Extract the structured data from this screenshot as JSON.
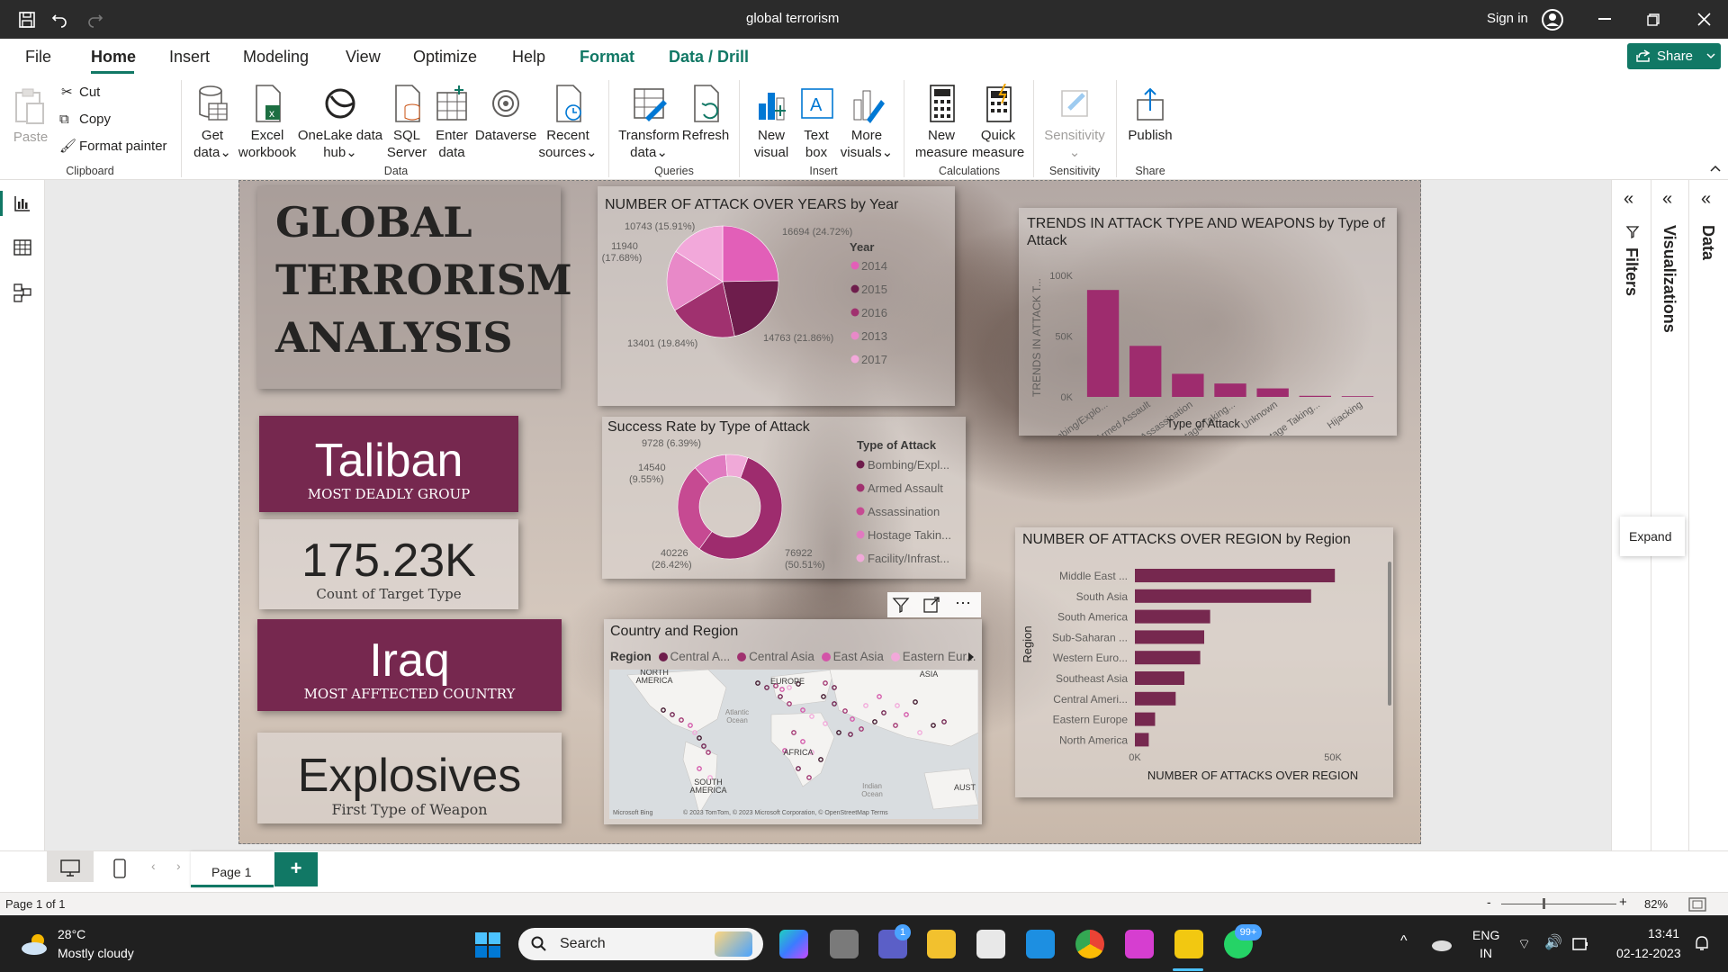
{
  "window": {
    "title": "global terrorism",
    "sign_in": "Sign in"
  },
  "menu": {
    "items": [
      "File",
      "Home",
      "Insert",
      "Modeling",
      "View",
      "Optimize",
      "Help",
      "Format",
      "Data / Drill"
    ],
    "share": "Share"
  },
  "ribbon": {
    "clipboard": {
      "paste": "Paste",
      "cut": "Cut",
      "copy": "Copy",
      "format_painter": "Format painter",
      "group": "Clipboard"
    },
    "data": {
      "get_data_1": "Get",
      "get_data_2": "data",
      "excel_1": "Excel",
      "excel_2": "workbook",
      "onelake_1": "OneLake data",
      "onelake_2": "hub",
      "sql_1": "SQL",
      "sql_2": "Server",
      "enter_1": "Enter",
      "enter_2": "data",
      "dataverse": "Dataverse",
      "recent_1": "Recent",
      "recent_2": "sources",
      "group": "Data"
    },
    "queries": {
      "transform_1": "Transform",
      "transform_2": "data",
      "refresh": "Refresh",
      "group": "Queries"
    },
    "insert": {
      "new_visual_1": "New",
      "new_visual_2": "visual",
      "text_box_1": "Text",
      "text_box_2": "box",
      "more_visuals_1": "More",
      "more_visuals_2": "visuals",
      "group": "Insert"
    },
    "calculations": {
      "new_measure_1": "New",
      "new_measure_2": "measure",
      "quick_measure_1": "Quick",
      "quick_measure_2": "measure",
      "group": "Calculations"
    },
    "sensitivity": {
      "label": "Sensitivity",
      "group": "Sensitivity"
    },
    "share": {
      "publish": "Publish",
      "group": "Share"
    }
  },
  "report": {
    "main_title": [
      "GLOBAL",
      "TERRORISM",
      "ANALYSIS"
    ],
    "kpi_group": {
      "value": "Taliban",
      "label": "MOST DEADLY GROUP"
    },
    "kpi_count": {
      "value": "175.23K",
      "label": "Count of Target Type"
    },
    "kpi_country": {
      "value": "Iraq",
      "label": "MOST AFFTECTED COUNTRY"
    },
    "kpi_weapon": {
      "value": "Explosives",
      "label": "First Type of Weapon"
    },
    "map": {
      "title": "Country and Region",
      "legend_title": "Region",
      "legend": [
        "Central A...",
        "Central Asia",
        "East Asia",
        "Eastern Eur..."
      ],
      "labels": {
        "na": "NORTH AMERICA",
        "europe": "EUROPE",
        "africa": "AFRICA",
        "sa": "SOUTH AMERICA",
        "asia": "ASIA",
        "atlantic": "Atlantic Ocean",
        "indian": "Indian Ocean",
        "aust": "AUST"
      },
      "credit": "© 2023 TomTom, © 2023 Microsoft Corporation, © OpenStreetMap  Terms",
      "bing": "Microsoft Bing"
    },
    "expand_tooltip": "Expand"
  },
  "chart_data": [
    {
      "type": "pie",
      "title": "NUMBER OF ATTACK OVER YEARS by Year",
      "legend_title": "Year",
      "categories": [
        "2014",
        "2015",
        "2016",
        "2013",
        "2017"
      ],
      "values": [
        16694,
        14763,
        13401,
        11940,
        10743
      ],
      "labels": [
        "16694 (24.72%)",
        "14763 (21.86%)",
        "13401 (19.84%)",
        "11940 (17.68%)",
        "10743 (15.91%)"
      ],
      "colors": [
        "#e25fb8",
        "#6e1d4c",
        "#a0316f",
        "#e889c8",
        "#f2a8da"
      ]
    },
    {
      "type": "pie",
      "donut": true,
      "title": "Success Rate by Type of Attack",
      "legend_title": "Type of Attack",
      "categories": [
        "Bombing/Expl...",
        "Armed Assault",
        "Assassination",
        "Hostage Takin...",
        "Facility/Infrast..."
      ],
      "values": [
        76922,
        40226,
        14540,
        9728
      ],
      "labels": [
        "76922 (50.51%)",
        "40226 (26.42%)",
        "14540 (9.55%)",
        "9728 (6.39%)"
      ],
      "colors": [
        "#9e2c6e",
        "#c64a92",
        "#e07ac0",
        "#f0a9d8",
        "#f7c8e8"
      ]
    },
    {
      "type": "bar",
      "title": "TRENDS IN ATTACK TYPE AND WEAPONS by Type of Attack",
      "xlabel": "Type of Attack",
      "ylabel": "TRENDS IN ATTACK T...",
      "categories": [
        "Bombing/Explo...",
        "Armed Assault",
        "Assassination",
        "Hostage Taking...",
        "Unknown",
        "Hostage Taking...",
        "Hijacking"
      ],
      "values": [
        88000,
        42000,
        19000,
        11000,
        7000,
        900,
        600
      ],
      "ylim": [
        0,
        100000
      ],
      "yticks": [
        "0K",
        "50K",
        "100K"
      ],
      "color": "#9e2c6e"
    },
    {
      "type": "bar",
      "orientation": "horizontal",
      "title": "NUMBER OF ATTACKS OVER REGION by Region",
      "xlabel": "NUMBER OF ATTACKS OVER REGION",
      "ylabel": "Region",
      "categories": [
        "Middle East ...",
        "South Asia",
        "South America",
        "Sub-Saharan ...",
        "Western Euro...",
        "Southeast Asia",
        "Central Ameri...",
        "Eastern Europe",
        "North America"
      ],
      "values": [
        50500,
        44500,
        19000,
        17500,
        16500,
        12500,
        10300,
        5100,
        3500
      ],
      "xlim": [
        0,
        60000
      ],
      "xticks": [
        "0K",
        "50K"
      ],
      "color": "#76284f"
    }
  ],
  "panes": {
    "filters": "Filters",
    "visualizations": "Visualizations",
    "data": "Data"
  },
  "pages": {
    "page1": "Page 1",
    "add": "+"
  },
  "status": {
    "page": "Page 1 of 1",
    "zoom": "82%"
  },
  "taskbar": {
    "temp": "28°C",
    "weather": "Mostly cloudy",
    "search": "Search",
    "lang1": "ENG",
    "lang2": "IN",
    "time": "13:41",
    "date": "02-12-2023",
    "badge1": "1",
    "badge2": "99+"
  }
}
